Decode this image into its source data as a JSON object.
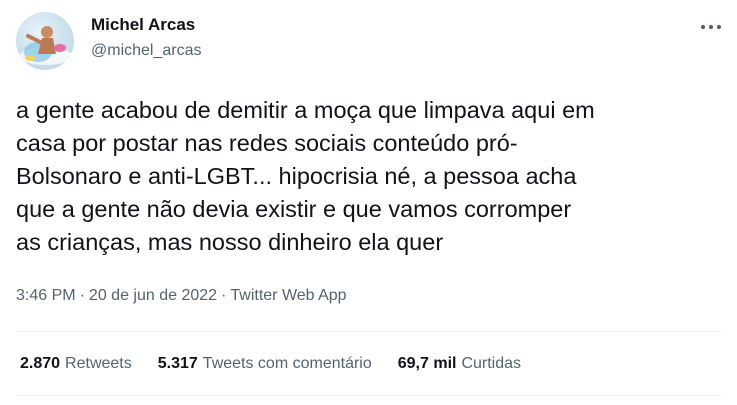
{
  "author": {
    "display_name": "Michel Arcas",
    "handle": "@michel_arcas"
  },
  "tweet": {
    "text": "a gente acabou de demitir a moça que limpava aqui em\ncasa por postar nas redes sociais conteúdo pró-\nBolsonaro e anti-LGBT... hipocrisia né, a pessoa acha\nque a gente não devia existir e que vamos corromper\nas crianças, mas nosso dinheiro ela quer"
  },
  "meta": {
    "time": "3:46 PM",
    "separator": "·",
    "date": "20 de jun de 2022",
    "source": "Twitter Web App"
  },
  "stats": [
    {
      "value": "2.870",
      "label": "Retweets"
    },
    {
      "value": "5.317",
      "label": "Tweets com comentário"
    },
    {
      "value": "69,7 mil",
      "label": "Curtidas"
    }
  ],
  "icons": {
    "more": "more-horizontal-icon"
  },
  "colors": {
    "text_primary": "#0f1419",
    "text_secondary": "#536471",
    "divider": "#eff3f4"
  }
}
